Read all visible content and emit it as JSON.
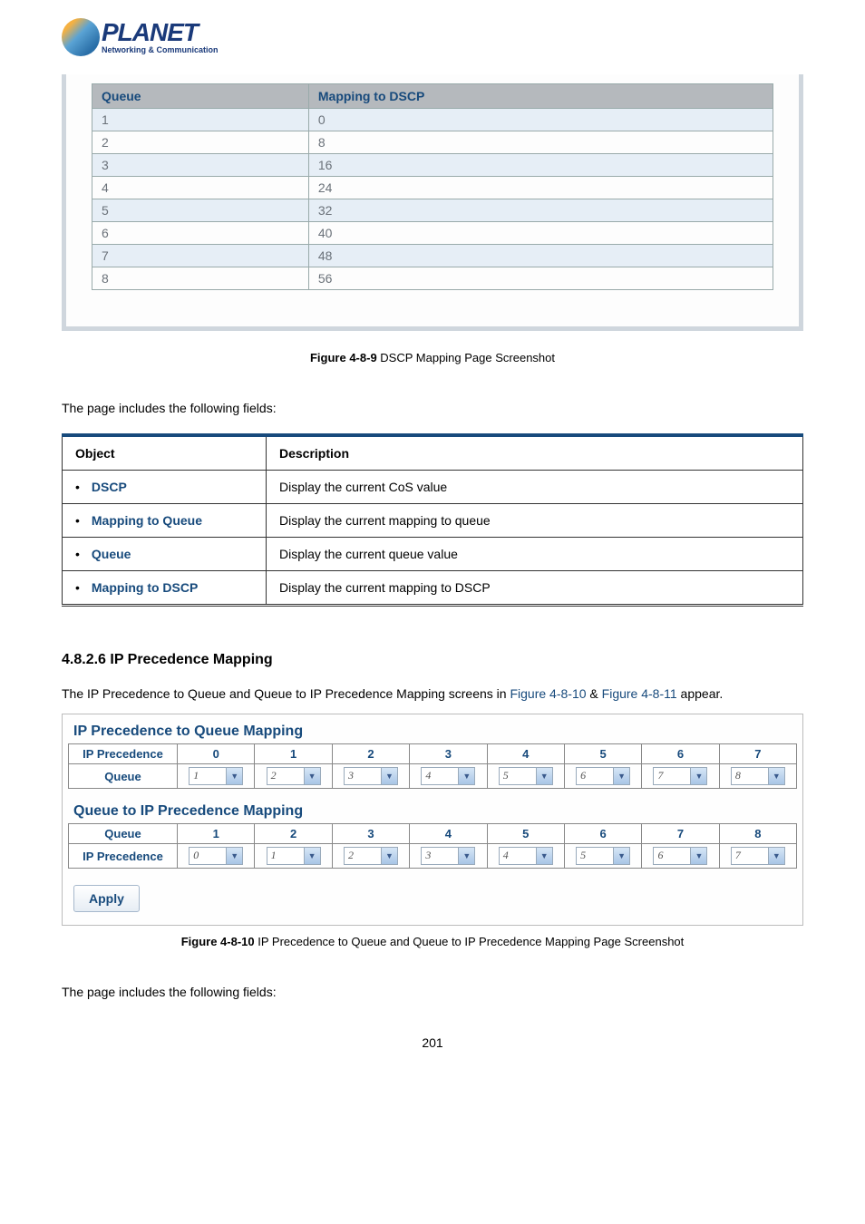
{
  "logo": {
    "brand": "PLANET",
    "tagline": "Networking & Communication"
  },
  "dscp_table": {
    "headers": [
      "Queue",
      "Mapping to DSCP"
    ],
    "rows": [
      {
        "queue": "1",
        "dscp": "0"
      },
      {
        "queue": "2",
        "dscp": "8"
      },
      {
        "queue": "3",
        "dscp": "16"
      },
      {
        "queue": "4",
        "dscp": "24"
      },
      {
        "queue": "5",
        "dscp": "32"
      },
      {
        "queue": "6",
        "dscp": "40"
      },
      {
        "queue": "7",
        "dscp": "48"
      },
      {
        "queue": "8",
        "dscp": "56"
      }
    ]
  },
  "figure_4_8_9": {
    "label": "Figure 4-8-9",
    "text": " DSCP Mapping Page Screenshot"
  },
  "fields_intro": "The page includes the following fields:",
  "desc_table": {
    "headers": {
      "object": "Object",
      "description": "Description"
    },
    "rows": [
      {
        "object": "DSCP",
        "description": "Display the current CoS value"
      },
      {
        "object": "Mapping to Queue",
        "description": "Display the current mapping to queue"
      },
      {
        "object": "Queue",
        "description": "Display the current queue value"
      },
      {
        "object": "Mapping to DSCP",
        "description": "Display the current mapping to DSCP"
      }
    ]
  },
  "section_heading": "4.8.2.6 IP Precedence Mapping",
  "section_text_pre": "The IP Precedence to Queue and Queue to IP Precedence Mapping screens in ",
  "ref1": "Figure 4-8-10",
  "amp": " & ",
  "ref2": "Figure 4-8-11",
  "section_text_post": " appear.",
  "ipq": {
    "title": "IP Precedence to Queue Mapping",
    "row_ip": "IP Precedence",
    "row_queue": "Queue",
    "headers": [
      "0",
      "1",
      "2",
      "3",
      "4",
      "5",
      "6",
      "7"
    ],
    "values": [
      "1",
      "2",
      "3",
      "4",
      "5",
      "6",
      "7",
      "8"
    ]
  },
  "qip": {
    "title": "Queue to IP Precedence Mapping",
    "row_queue": "Queue",
    "row_ip": "IP Precedence",
    "headers": [
      "1",
      "2",
      "3",
      "4",
      "5",
      "6",
      "7",
      "8"
    ],
    "values": [
      "0",
      "1",
      "2",
      "3",
      "4",
      "5",
      "6",
      "7"
    ]
  },
  "apply_label": "Apply",
  "figure_4_8_10": {
    "label": "Figure 4-8-10",
    "text": " IP Precedence to Queue and Queue to IP Precedence Mapping Page Screenshot"
  },
  "fields_intro_2": "The page includes the following fields:",
  "page_number": "201"
}
